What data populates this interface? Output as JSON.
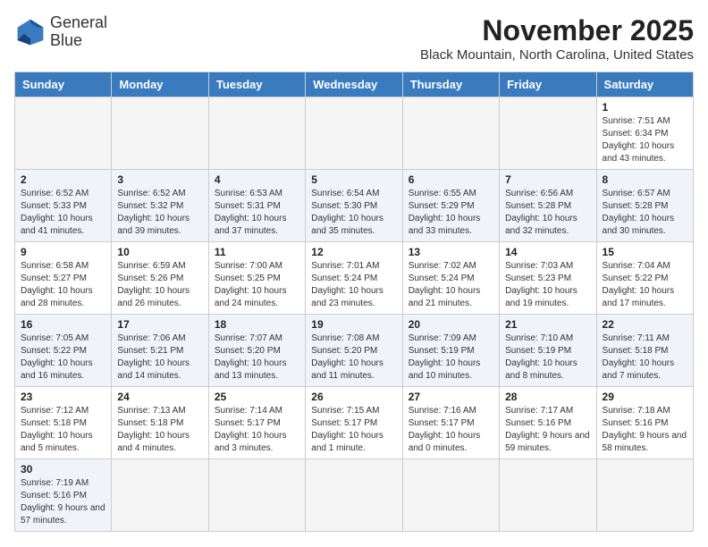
{
  "logo": {
    "line1": "General",
    "line2": "Blue"
  },
  "title": "November 2025",
  "location": "Black Mountain, North Carolina, United States",
  "days_of_week": [
    "Sunday",
    "Monday",
    "Tuesday",
    "Wednesday",
    "Thursday",
    "Friday",
    "Saturday"
  ],
  "weeks": [
    [
      {
        "day": "",
        "info": ""
      },
      {
        "day": "",
        "info": ""
      },
      {
        "day": "",
        "info": ""
      },
      {
        "day": "",
        "info": ""
      },
      {
        "day": "",
        "info": ""
      },
      {
        "day": "",
        "info": ""
      },
      {
        "day": "1",
        "info": "Sunrise: 7:51 AM\nSunset: 6:34 PM\nDaylight: 10 hours and 43 minutes."
      }
    ],
    [
      {
        "day": "2",
        "info": "Sunrise: 6:52 AM\nSunset: 5:33 PM\nDaylight: 10 hours and 41 minutes."
      },
      {
        "day": "3",
        "info": "Sunrise: 6:52 AM\nSunset: 5:32 PM\nDaylight: 10 hours and 39 minutes."
      },
      {
        "day": "4",
        "info": "Sunrise: 6:53 AM\nSunset: 5:31 PM\nDaylight: 10 hours and 37 minutes."
      },
      {
        "day": "5",
        "info": "Sunrise: 6:54 AM\nSunset: 5:30 PM\nDaylight: 10 hours and 35 minutes."
      },
      {
        "day": "6",
        "info": "Sunrise: 6:55 AM\nSunset: 5:29 PM\nDaylight: 10 hours and 33 minutes."
      },
      {
        "day": "7",
        "info": "Sunrise: 6:56 AM\nSunset: 5:28 PM\nDaylight: 10 hours and 32 minutes."
      },
      {
        "day": "8",
        "info": "Sunrise: 6:57 AM\nSunset: 5:28 PM\nDaylight: 10 hours and 30 minutes."
      }
    ],
    [
      {
        "day": "9",
        "info": "Sunrise: 6:58 AM\nSunset: 5:27 PM\nDaylight: 10 hours and 28 minutes."
      },
      {
        "day": "10",
        "info": "Sunrise: 6:59 AM\nSunset: 5:26 PM\nDaylight: 10 hours and 26 minutes."
      },
      {
        "day": "11",
        "info": "Sunrise: 7:00 AM\nSunset: 5:25 PM\nDaylight: 10 hours and 24 minutes."
      },
      {
        "day": "12",
        "info": "Sunrise: 7:01 AM\nSunset: 5:24 PM\nDaylight: 10 hours and 23 minutes."
      },
      {
        "day": "13",
        "info": "Sunrise: 7:02 AM\nSunset: 5:24 PM\nDaylight: 10 hours and 21 minutes."
      },
      {
        "day": "14",
        "info": "Sunrise: 7:03 AM\nSunset: 5:23 PM\nDaylight: 10 hours and 19 minutes."
      },
      {
        "day": "15",
        "info": "Sunrise: 7:04 AM\nSunset: 5:22 PM\nDaylight: 10 hours and 17 minutes."
      }
    ],
    [
      {
        "day": "16",
        "info": "Sunrise: 7:05 AM\nSunset: 5:22 PM\nDaylight: 10 hours and 16 minutes."
      },
      {
        "day": "17",
        "info": "Sunrise: 7:06 AM\nSunset: 5:21 PM\nDaylight: 10 hours and 14 minutes."
      },
      {
        "day": "18",
        "info": "Sunrise: 7:07 AM\nSunset: 5:20 PM\nDaylight: 10 hours and 13 minutes."
      },
      {
        "day": "19",
        "info": "Sunrise: 7:08 AM\nSunset: 5:20 PM\nDaylight: 10 hours and 11 minutes."
      },
      {
        "day": "20",
        "info": "Sunrise: 7:09 AM\nSunset: 5:19 PM\nDaylight: 10 hours and 10 minutes."
      },
      {
        "day": "21",
        "info": "Sunrise: 7:10 AM\nSunset: 5:19 PM\nDaylight: 10 hours and 8 minutes."
      },
      {
        "day": "22",
        "info": "Sunrise: 7:11 AM\nSunset: 5:18 PM\nDaylight: 10 hours and 7 minutes."
      }
    ],
    [
      {
        "day": "23",
        "info": "Sunrise: 7:12 AM\nSunset: 5:18 PM\nDaylight: 10 hours and 5 minutes."
      },
      {
        "day": "24",
        "info": "Sunrise: 7:13 AM\nSunset: 5:18 PM\nDaylight: 10 hours and 4 minutes."
      },
      {
        "day": "25",
        "info": "Sunrise: 7:14 AM\nSunset: 5:17 PM\nDaylight: 10 hours and 3 minutes."
      },
      {
        "day": "26",
        "info": "Sunrise: 7:15 AM\nSunset: 5:17 PM\nDaylight: 10 hours and 1 minute."
      },
      {
        "day": "27",
        "info": "Sunrise: 7:16 AM\nSunset: 5:17 PM\nDaylight: 10 hours and 0 minutes."
      },
      {
        "day": "28",
        "info": "Sunrise: 7:17 AM\nSunset: 5:16 PM\nDaylight: 9 hours and 59 minutes."
      },
      {
        "day": "29",
        "info": "Sunrise: 7:18 AM\nSunset: 5:16 PM\nDaylight: 9 hours and 58 minutes."
      }
    ],
    [
      {
        "day": "30",
        "info": "Sunrise: 7:19 AM\nSunset: 5:16 PM\nDaylight: 9 hours and 57 minutes."
      },
      {
        "day": "",
        "info": ""
      },
      {
        "day": "",
        "info": ""
      },
      {
        "day": "",
        "info": ""
      },
      {
        "day": "",
        "info": ""
      },
      {
        "day": "",
        "info": ""
      },
      {
        "day": "",
        "info": ""
      }
    ]
  ]
}
